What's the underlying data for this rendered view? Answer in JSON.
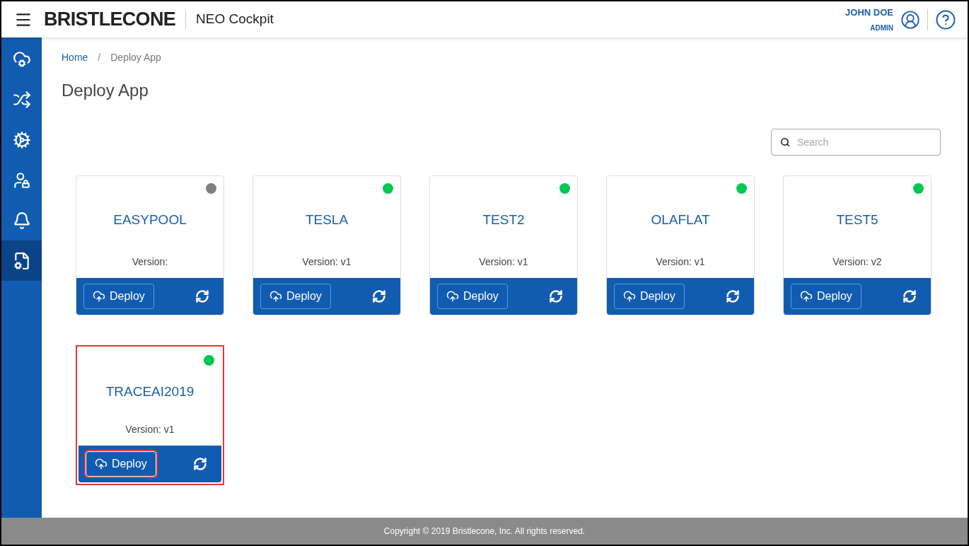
{
  "header": {
    "logo": "BRISTLECONE",
    "app_name": "NEO Cockpit",
    "user_name": "JOHN DOE",
    "user_role": "ADMIN"
  },
  "sidebar": {
    "items": [
      {
        "kind": "cloud",
        "selected": false
      },
      {
        "kind": "flow",
        "selected": false
      },
      {
        "kind": "gears",
        "selected": false
      },
      {
        "kind": "user-lock",
        "selected": false
      },
      {
        "kind": "bell",
        "selected": false
      },
      {
        "kind": "deploy",
        "selected": true
      }
    ]
  },
  "breadcrumb": [
    "Home",
    "/",
    "Deploy App"
  ],
  "page_title": "Deploy App",
  "search": {
    "placeholder": "Search"
  },
  "apps": [
    {
      "name": "EASYPOOL",
      "version": "Version:",
      "color": "#808080",
      "button": "Deploy",
      "highlighted": false
    },
    {
      "name": "TESLA",
      "version": "Version: v1",
      "color": "#00c853",
      "button": "Deploy",
      "highlighted": false
    },
    {
      "name": "TEST2",
      "version": "Version: v1",
      "color": "#00c853",
      "button": "Deploy",
      "highlighted": false
    },
    {
      "name": "OLAFLAT",
      "version": "Version: v1",
      "color": "#00c853",
      "button": "Deploy",
      "highlighted": false
    },
    {
      "name": "TEST5",
      "version": "Version: v2",
      "color": "#00c853",
      "button": "Deploy",
      "highlighted": false
    },
    {
      "name": "TRACEAI2019",
      "version": "Version: v1",
      "color": "#00c853",
      "button": "Deploy",
      "highlighted": true
    }
  ],
  "footer": "Copyright © 2019 Bristlecone, Inc. All rights reserved."
}
